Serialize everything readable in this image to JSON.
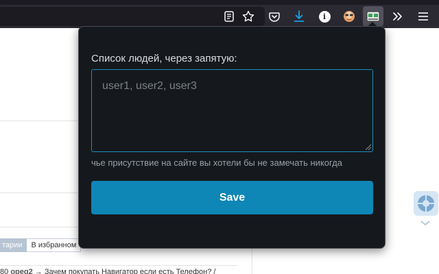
{
  "popup": {
    "label": "Список людей, через запятую:",
    "textarea_value": "",
    "textarea_placeholder": "user1, user2, user3",
    "hint": "чье присутствие на сайте вы хотели бы не замечать никогда",
    "save_label": "Save"
  },
  "page": {
    "tabs": [
      "тарии",
      "В избранном"
    ],
    "active_tab": "тарии",
    "comment_prefix": "80",
    "comment_user": "ореq2",
    "comment_text": "→ Зачем покупать Навигатор если есть Телефон? /"
  },
  "toolbar": {
    "icons": [
      "reader-view-icon",
      "bookmark-star-icon",
      "pocket-icon",
      "download-icon",
      "info-icon",
      "avatar-extension-icon",
      "tracker-blocker-extension-icon",
      "overflow-chevrons-icon",
      "menu-icon"
    ],
    "download_color": "#1aa3e6",
    "info_glyph": "i"
  },
  "colors": {
    "popup_bg": "#15191d",
    "accent": "#0e86b6",
    "textarea_border": "#1e8fc0"
  }
}
